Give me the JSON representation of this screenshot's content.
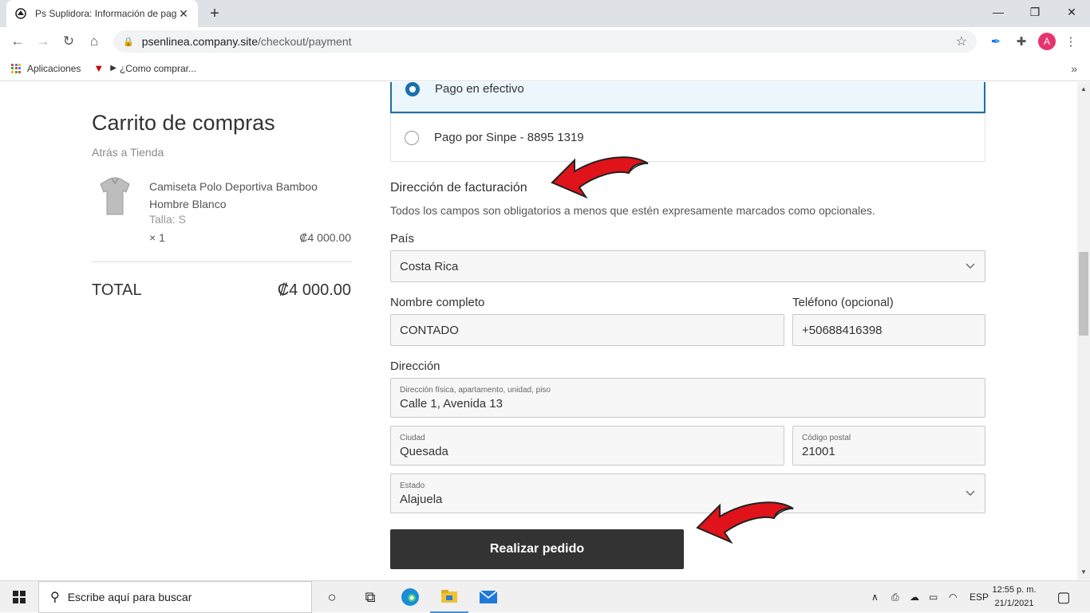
{
  "browser": {
    "tab_title": "Ps Suplidora: Información de pag",
    "url_host": "psenlinea.company.site",
    "url_path": "/checkout/payment",
    "avatar_letter": "A",
    "bookmarks": [
      {
        "label": "Aplicaciones"
      },
      {
        "label": "¿Como comprar..."
      }
    ]
  },
  "cart": {
    "title": "Carrito de compras",
    "back_link": "Atrás a Tienda",
    "item": {
      "name": "Camiseta Polo Deportiva Bamboo Hombre Blanco",
      "size": "Talla: S",
      "qty": "× 1",
      "price": "₡4 000.00"
    },
    "total_label": "TOTAL",
    "total_value": "₡4 000.00"
  },
  "payment": {
    "options": [
      {
        "label": "Pago en efectivo",
        "selected": true
      },
      {
        "label": "Pago por Sinpe - 8895 1319",
        "selected": false
      }
    ]
  },
  "billing": {
    "title": "Dirección de facturación",
    "description": "Todos los campos son obligatorios a menos que estén expresamente marcados como opcionales.",
    "country_label": "País",
    "country_value": "Costa Rica",
    "name_label": "Nombre completo",
    "name_value": "CONTADO",
    "phone_label": "Teléfono (opcional)",
    "phone_value": "+50688416398",
    "address_label": "Dirección",
    "street_hint": "Dirección física, apartamento, unidad, piso",
    "street_value": "Calle 1, Avenida 13",
    "city_hint": "Ciudad",
    "city_value": "Quesada",
    "zip_hint": "Código postal",
    "zip_value": "21001",
    "state_hint": "Estado",
    "state_value": "Alajuela",
    "submit_label": "Realizar pedido"
  },
  "taskbar": {
    "search_placeholder": "Escribe aquí para buscar",
    "lang": "ESP",
    "time": "12:55 p. m.",
    "date": "21/1/2021"
  },
  "colors": {
    "accent": "#1a6fab",
    "selected_bg": "#ecf6fd",
    "button_bg": "#333333",
    "arrow_red": "#e0131a"
  }
}
